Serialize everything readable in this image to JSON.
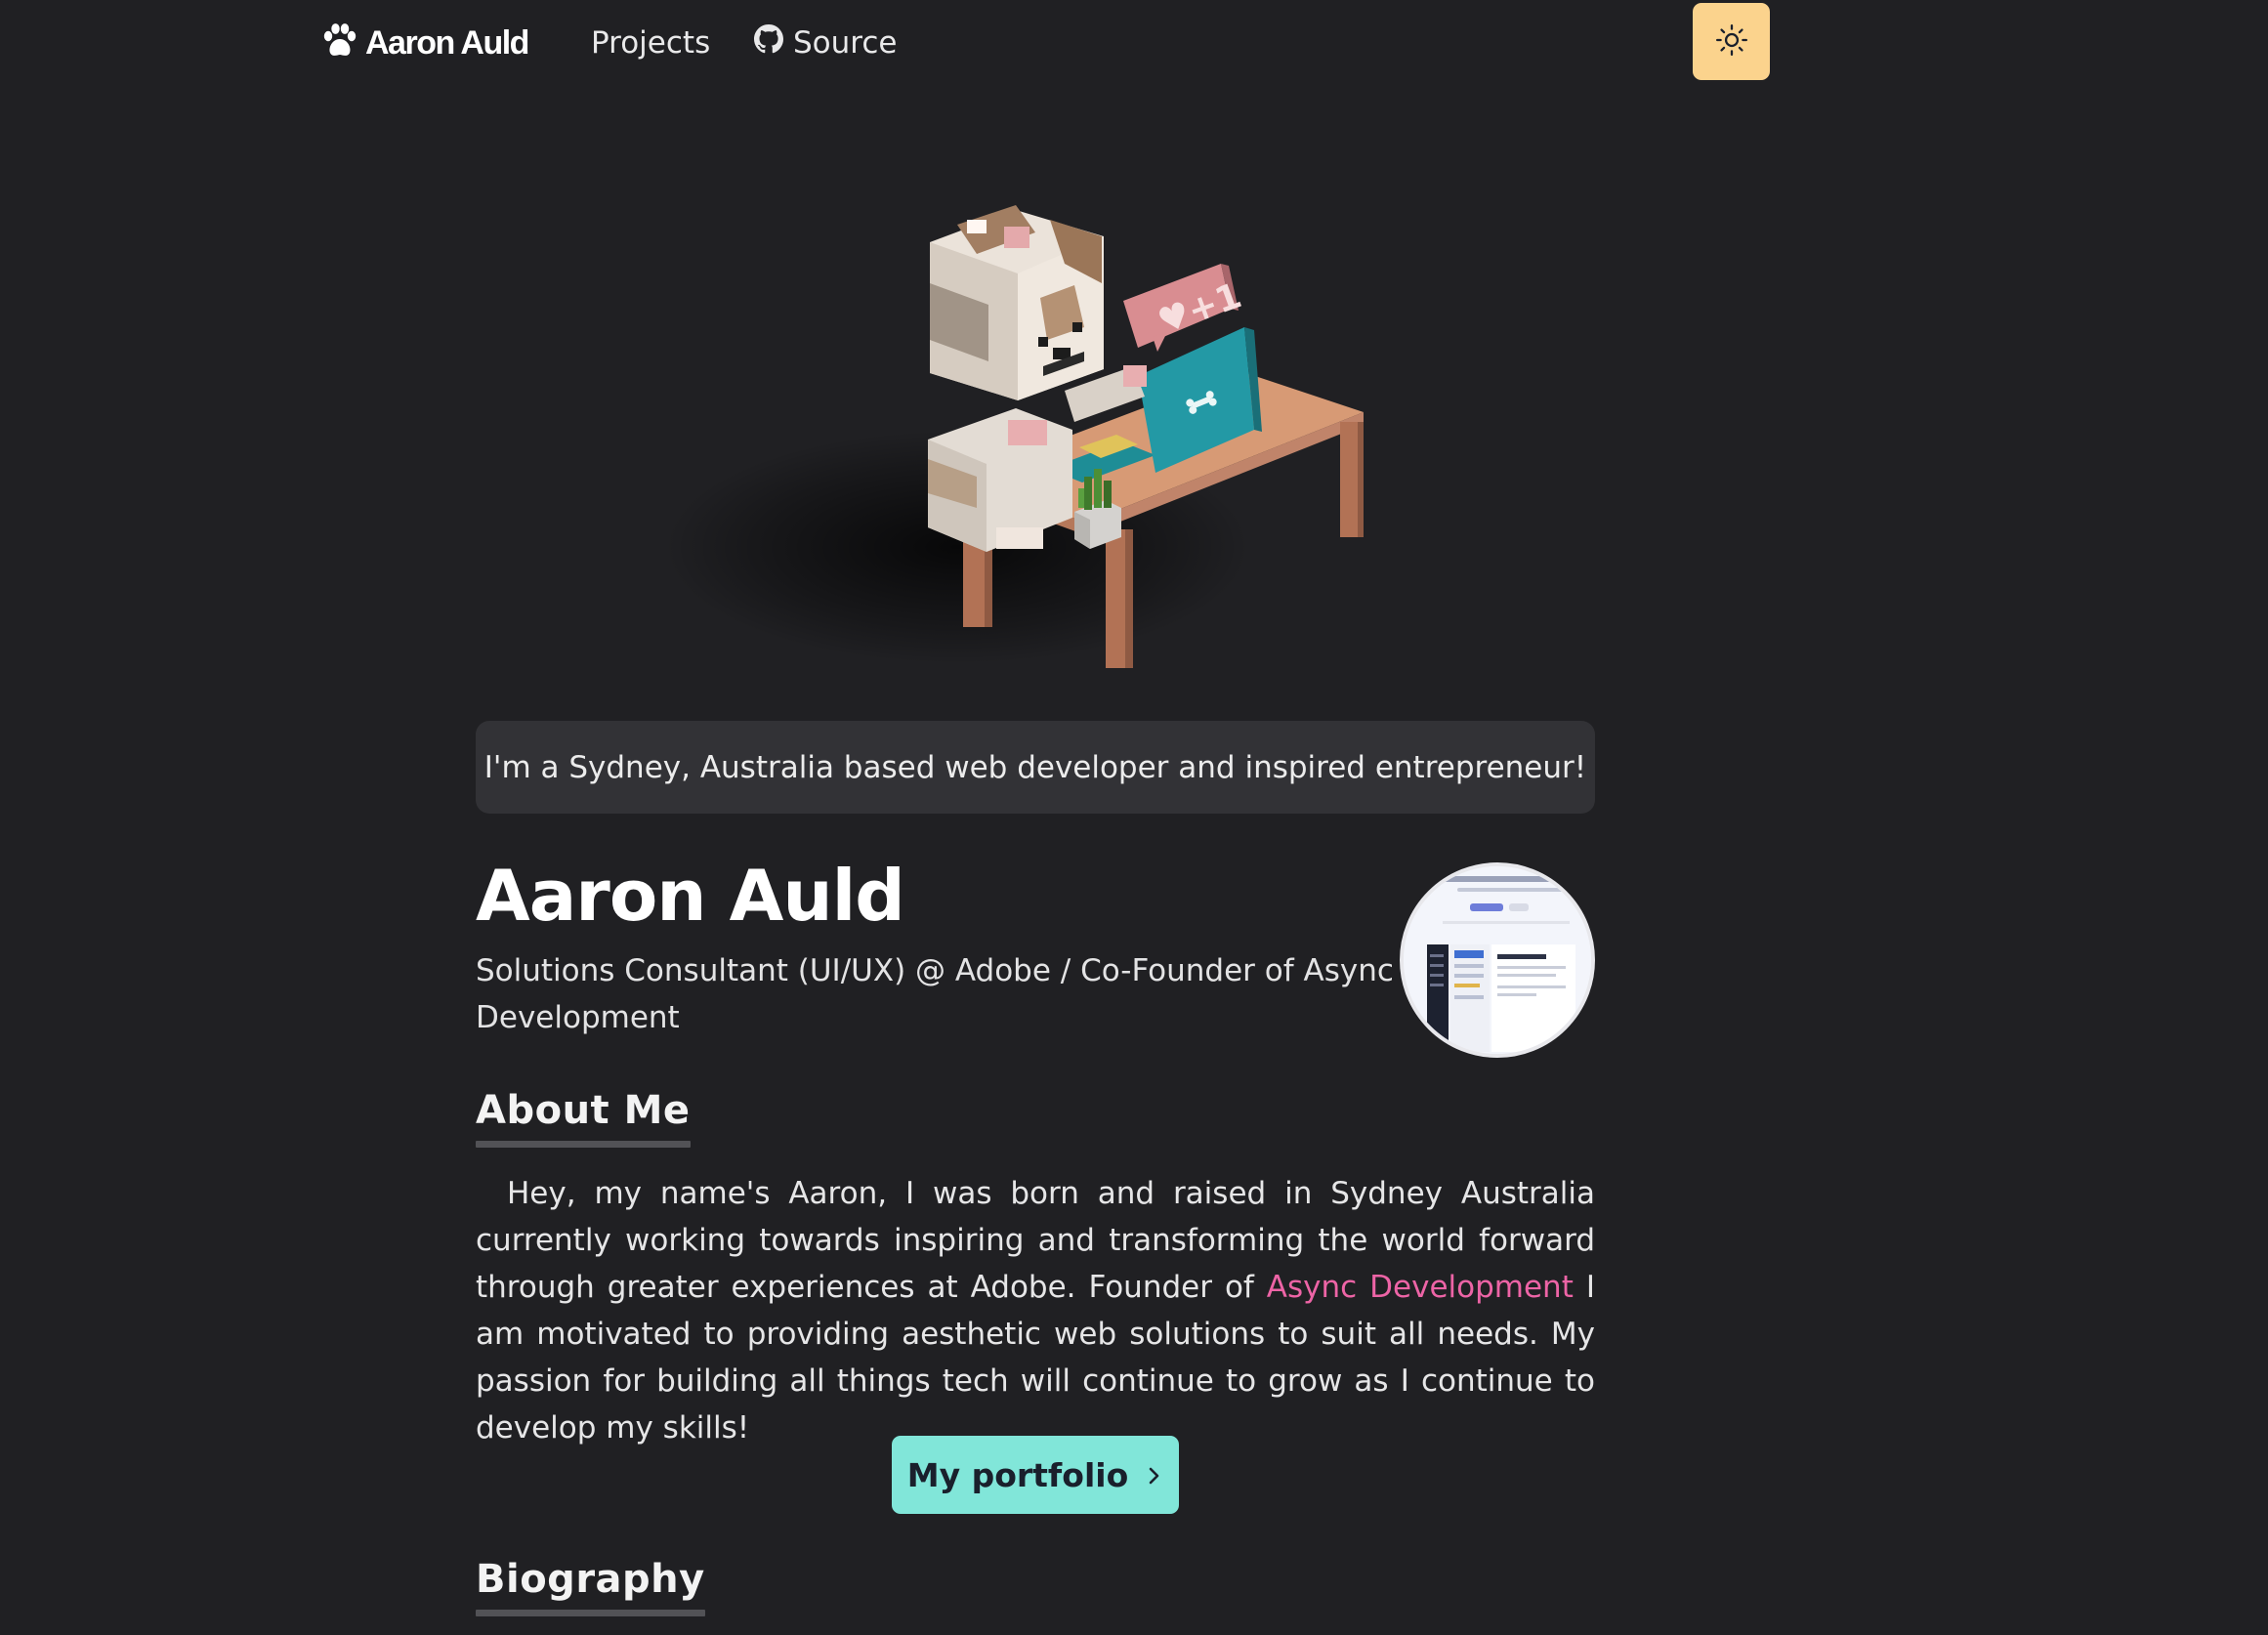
{
  "nav": {
    "logo_text": "Aaron Auld",
    "links": [
      {
        "label": "Projects"
      },
      {
        "label": "Source"
      }
    ]
  },
  "hero": {
    "tagline": "I'm a Sydney, Australia based web developer and inspired entrepreneur!"
  },
  "profile": {
    "name": "Aaron Auld",
    "role": "Solutions Consultant (UI/UX) @ Adobe / Co-Founder of Async Development"
  },
  "about": {
    "heading": "About Me",
    "text_before": "Hey, my name's Aaron, I was born and raised in Sydney Australia currently working towards inspiring and transforming the world forward through greater experiences at Adobe. Founder of ",
    "link_text": "Async Development",
    "text_after": " I am motivated to providing aesthetic web solutions to suit all needs. My passion for building all things tech will continue to grow as I continue to develop my skills!",
    "button_label": "My portfolio"
  },
  "biography": {
    "heading": "Biography"
  },
  "colors": {
    "background": "#202023",
    "accent_link": "#ed64a6",
    "button_bg": "#81e6d9",
    "theme_toggle_bg": "#fbd38d"
  },
  "icons": [
    "paw-icon",
    "github-icon",
    "sun-icon",
    "chevron-right-icon"
  ]
}
